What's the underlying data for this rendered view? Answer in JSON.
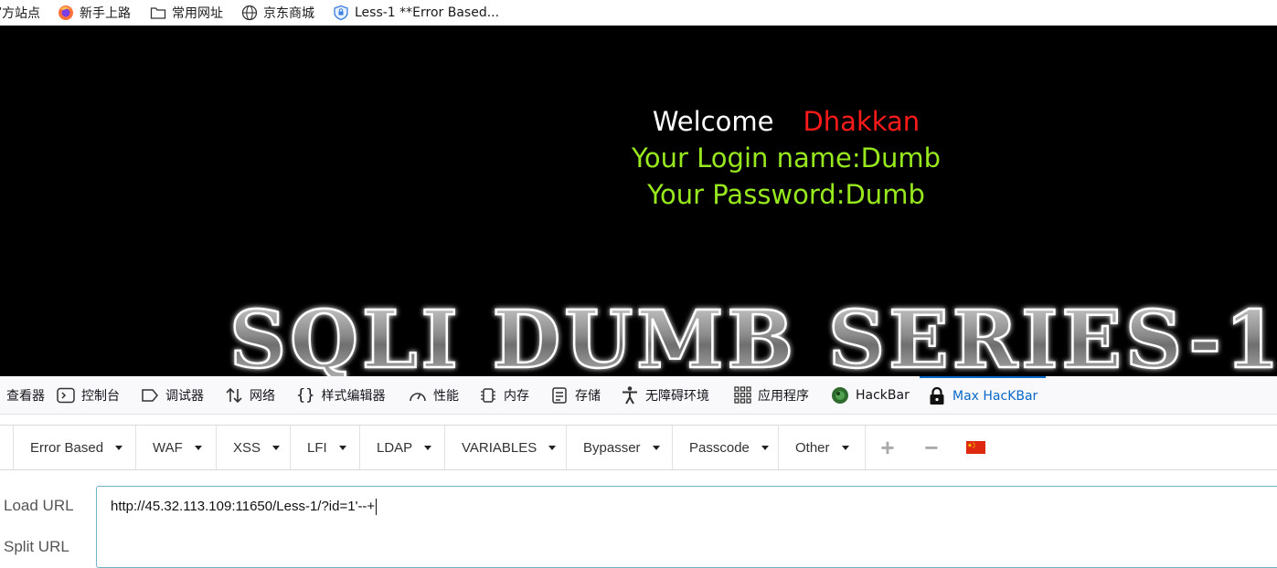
{
  "bookmarks": [
    {
      "label": "官方站点",
      "icon": "firefox-logo-icon"
    },
    {
      "label": "新手上路",
      "icon": "firefox-logo-icon"
    },
    {
      "label": "常用网址",
      "icon": "folder-icon"
    },
    {
      "label": "京东商城",
      "icon": "globe-icon"
    },
    {
      "label": "Less-1 **Error Based...",
      "icon": "shield-icon"
    }
  ],
  "page": {
    "welcome": "Welcome",
    "name": "Dhakkan",
    "login_line": "Your Login name:Dumb",
    "password_line": "Your Password:Dumb",
    "banner": "SQLI DUMB SERIES-1",
    "colors": {
      "background": "#000000",
      "welcome": "#ffffff",
      "name": "#ff1a1a",
      "info": "#98e81e"
    }
  },
  "devtools": {
    "tabs": [
      {
        "label": "查看器",
        "icon": "inspector-icon"
      },
      {
        "label": "控制台",
        "icon": "console-icon"
      },
      {
        "label": "调试器",
        "icon": "debugger-icon"
      },
      {
        "label": "网络",
        "icon": "network-icon"
      },
      {
        "label": "样式编辑器",
        "icon": "style-editor-icon"
      },
      {
        "label": "性能",
        "icon": "performance-icon"
      },
      {
        "label": "内存",
        "icon": "memory-icon"
      },
      {
        "label": "存储",
        "icon": "storage-icon"
      },
      {
        "label": "无障碍环境",
        "icon": "accessibility-icon"
      },
      {
        "label": "应用程序",
        "icon": "application-icon"
      },
      {
        "label": "HackBar",
        "icon": "hackbar-icon"
      },
      {
        "label": "Max HacKBar",
        "icon": "lock-icon"
      }
    ],
    "active_tab": "Max HacKBar",
    "accent": "#0a68c8"
  },
  "hackbar": {
    "menu": [
      "Error Based",
      "WAF",
      "XSS",
      "LFI",
      "LDAP",
      "VARIABLES",
      "Bypasser",
      "Passcode",
      "Other"
    ],
    "controls": {
      "add": "+",
      "remove": "−",
      "flag": "china-flag-icon"
    },
    "load_url_label": "Load URL",
    "split_url_label": "Split URL",
    "url_value": "http://45.32.113.109:11650/Less-1/?id=1'--+"
  }
}
